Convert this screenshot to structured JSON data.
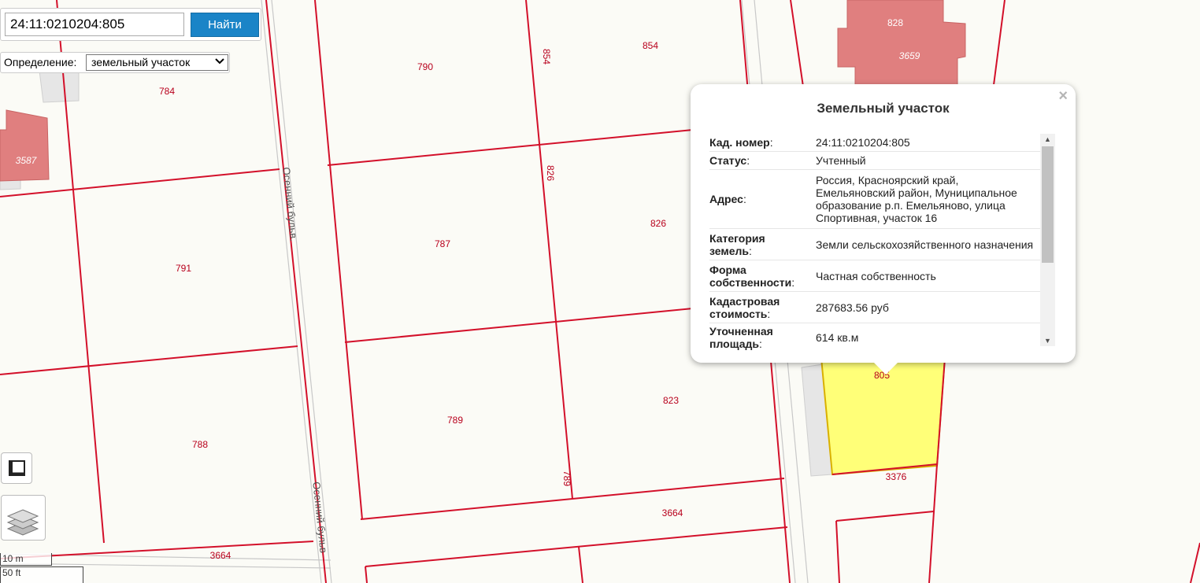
{
  "search": {
    "value": "24:11:0210204:805",
    "button_label": "Найти"
  },
  "definition": {
    "label": "Определение:",
    "selected": "земельный участок"
  },
  "map": {
    "parcel_labels": [
      "3587",
      "784",
      "790",
      "854",
      "854",
      "828",
      "3659",
      "791",
      "787",
      "826",
      "826",
      "788",
      "789",
      "789",
      "823",
      "3664",
      "3664",
      "805",
      "3376"
    ],
    "street_names": [
      "Осенний бульв.",
      "Осенний бульв"
    ],
    "highlight_color": "#ffff78",
    "boundary_color": "#d3102a",
    "building_color": "#e07f7f"
  },
  "popup": {
    "title": "Земельный участок",
    "close_glyph": "×",
    "rows": [
      {
        "key": "Кад. номер",
        "value": "24:11:0210204:805"
      },
      {
        "key": "Статус",
        "value": "Учтенный"
      },
      {
        "key": "Адрес",
        "value": "Россия, Красноярский край, Емельяновский район, Муниципальное образование р.п. Емельяново, улица Спортивная, участок 16"
      },
      {
        "key": "Категория земель",
        "value": "Земли сельскохозяйственного назначения"
      },
      {
        "key": "Форма собственности",
        "value": "Частная собственность"
      },
      {
        "key": "Кадастровая стоимость",
        "value": "287683.56 руб"
      },
      {
        "key": "Уточненная площадь",
        "value": "614 кв.м"
      }
    ]
  },
  "scale": {
    "metric": "10 m",
    "imperial": "50 ft"
  },
  "icons": {
    "measure": "ruler-icon",
    "layers": "layers-icon",
    "dropdown": "chevron-down-icon"
  }
}
